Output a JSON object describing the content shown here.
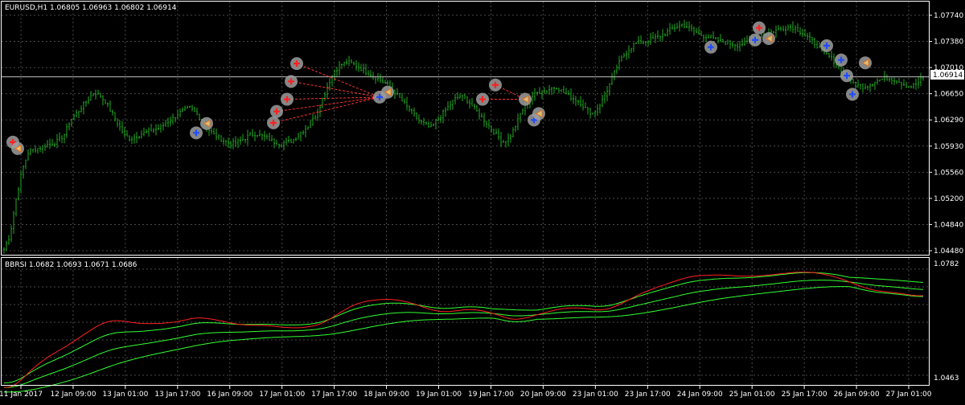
{
  "main_window": {
    "header": "EURUSD,H1  1.06805 1.06963 1.06802 1.06914",
    "current_price_label": "1.06914",
    "price_axis": [
      "1.07740",
      "1.07380",
      "1.07010",
      "1.06650",
      "1.06290",
      "1.05930",
      "1.05560",
      "1.05200",
      "1.04840",
      "1.04480"
    ]
  },
  "indicator_window": {
    "header": "BBRSI 1.0682 1.0693 1.0671 1.0686",
    "axis_top": "1.0782",
    "axis_bottom": "1.0463"
  },
  "time_axis": [
    "11 Jan 2017",
    "12 Jan 09:00",
    "13 Jan 01:00",
    "13 Jan 17:00",
    "16 Jan 09:00",
    "17 Jan 01:00",
    "17 Jan 17:00",
    "18 Jan 09:00",
    "19 Jan 01:00",
    "19 Jan 17:00",
    "20 Jan 09:00",
    "23 Jan 01:00",
    "23 Jan 17:00",
    "24 Jan 09:00",
    "25 Jan 01:00",
    "25 Jan 17:00",
    "26 Jan 09:00",
    "27 Jan 01:00"
  ],
  "colors": {
    "background": "#000000",
    "frame": "#ffffff",
    "grid": "#4a4a4a",
    "bars": "#22aa22",
    "rsi_line": "#ff2020",
    "band_lines": "#33ff33",
    "price_line": "#c0c0c0",
    "marker_ring": "#9e9e9e",
    "sell_arrow": "#ff2020",
    "buy_arrow": "#1f4bff",
    "close_marker": "#d6c27a",
    "trade_line": "#ff3030"
  },
  "chart_data": {
    "type": "line",
    "symbol": "EURUSD",
    "timeframe": "H1",
    "ohlc_last": {
      "open": 1.06805,
      "high": 1.06963,
      "low": 1.06802,
      "close": 1.06914
    },
    "price_range": [
      1.0448,
      1.079
    ],
    "close_series": [
      1.045,
      1.047,
      1.052,
      1.056,
      1.0585,
      1.059,
      1.0592,
      1.0596,
      1.0598,
      1.0602,
      1.061,
      1.063,
      1.064,
      1.065,
      1.066,
      1.067,
      1.0665,
      1.0655,
      1.064,
      1.0625,
      1.061,
      1.0605,
      1.0608,
      1.0612,
      1.0615,
      1.0618,
      1.062,
      1.0628,
      1.0632,
      1.064,
      1.0645,
      1.0648,
      1.064,
      1.063,
      1.0618,
      1.061,
      1.0605,
      1.06,
      1.0598,
      1.06,
      1.0605,
      1.061,
      1.0612,
      1.0608,
      1.0605,
      1.06,
      1.0598,
      1.06,
      1.0602,
      1.061,
      1.0618,
      1.0625,
      1.064,
      1.066,
      1.0682,
      1.07,
      1.0708,
      1.0712,
      1.071,
      1.0705,
      1.07,
      1.0695,
      1.069,
      1.0685,
      1.068,
      1.067,
      1.066,
      1.065,
      1.064,
      1.063,
      1.0625,
      1.062,
      1.063,
      1.064,
      1.065,
      1.066,
      1.0665,
      1.066,
      1.065,
      1.064,
      1.063,
      1.062,
      1.061,
      1.06,
      1.0605,
      1.062,
      1.064,
      1.0655,
      1.0665,
      1.067,
      1.0672,
      1.0675,
      1.0678,
      1.067,
      1.0665,
      1.066,
      1.0655,
      1.0645,
      1.064,
      1.065,
      1.0665,
      1.0685,
      1.0705,
      1.072,
      1.073,
      1.0738,
      1.074,
      1.0742,
      1.0745,
      1.0748,
      1.0752,
      1.0758,
      1.0762,
      1.0765,
      1.076,
      1.0755,
      1.075,
      1.0748,
      1.0745,
      1.0742,
      1.074,
      1.0738,
      1.0736,
      1.0738,
      1.074,
      1.0745,
      1.075,
      1.0752,
      1.0755,
      1.0758,
      1.076,
      1.0762,
      1.0758,
      1.0752,
      1.0745,
      1.0738,
      1.073,
      1.0722,
      1.0715,
      1.0705,
      1.0695,
      1.0685,
      1.068,
      1.0678,
      1.068,
      1.0685,
      1.0688,
      1.069,
      1.0688,
      1.0685,
      1.068,
      1.0678,
      1.0682,
      1.0691
    ],
    "markers": [
      {
        "type": "sell",
        "price": 1.06
      },
      {
        "type": "close",
        "price": 1.0591
      },
      {
        "type": "buy",
        "price": 1.0613
      },
      {
        "type": "close",
        "price": 1.0626
      },
      {
        "type": "sell",
        "price": 1.0627
      },
      {
        "type": "sell",
        "price": 1.0643
      },
      {
        "type": "sell",
        "price": 1.066
      },
      {
        "type": "sell",
        "price": 1.0685
      },
      {
        "type": "sell",
        "price": 1.071
      },
      {
        "type": "buy",
        "price": 1.0663
      },
      {
        "type": "close",
        "price": 1.067
      },
      {
        "type": "sell",
        "price": 1.066
      },
      {
        "type": "sell",
        "price": 1.068
      },
      {
        "type": "close",
        "price": 1.066
      },
      {
        "type": "buy",
        "price": 1.0631
      },
      {
        "type": "close",
        "price": 1.064
      },
      {
        "type": "buy",
        "price": 1.0733
      },
      {
        "type": "sell",
        "price": 1.076
      },
      {
        "type": "buy",
        "price": 1.0743
      },
      {
        "type": "close",
        "price": 1.0745
      },
      {
        "type": "buy",
        "price": 1.0735
      },
      {
        "type": "buy",
        "price": 1.0715
      },
      {
        "type": "buy",
        "price": 1.0693
      },
      {
        "type": "close",
        "price": 1.0711
      },
      {
        "type": "buy",
        "price": 1.0667
      }
    ],
    "indicator": {
      "name": "BBRSI",
      "values": [
        1.0682,
        1.0693,
        1.0671,
        1.0686
      ],
      "range": [
        1.0463,
        1.0782
      ]
    }
  }
}
